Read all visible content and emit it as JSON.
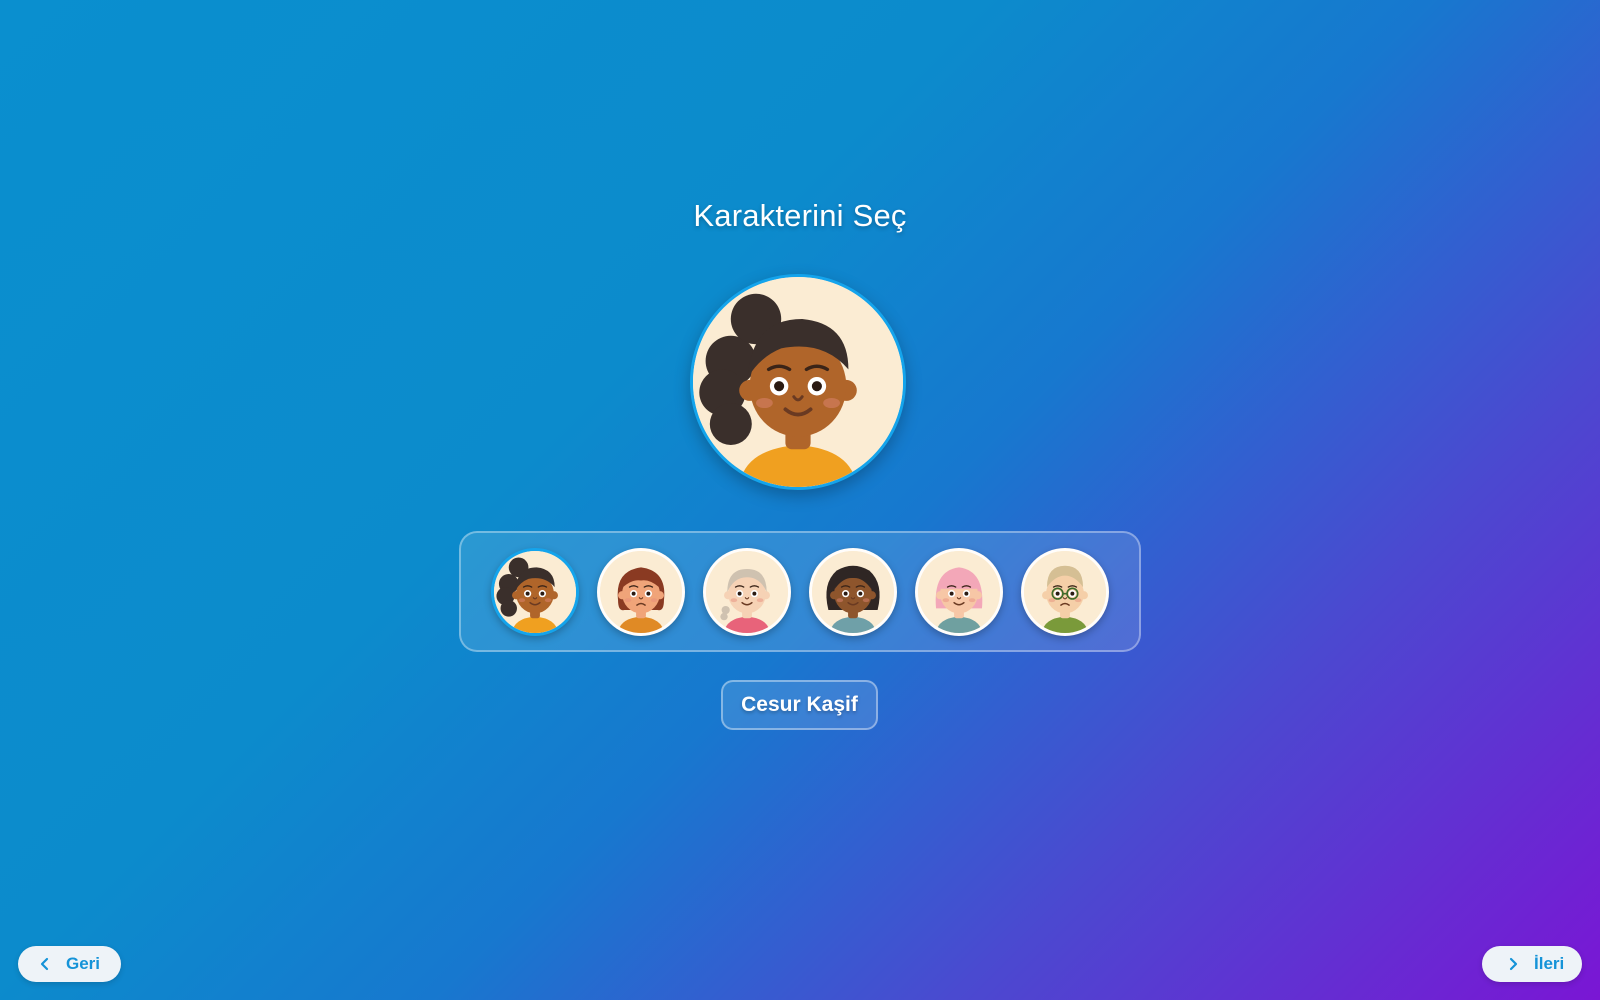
{
  "title": "Karakterini Seç",
  "selected_index": 0,
  "selected_name": "Cesur Kaşif",
  "accent_color": "#14a4ec",
  "characters": [
    {
      "id": "c1",
      "skin": "#b0652a",
      "hair": "#3a2f2b",
      "shirt": "#f0a020",
      "style": "curly-side",
      "mood": "smile"
    },
    {
      "id": "c2",
      "skin": "#f0a479",
      "hair": "#8a3a22",
      "shirt": "#e08a25",
      "style": "bob",
      "mood": "sad"
    },
    {
      "id": "c3",
      "skin": "#f6d2b5",
      "hair": "#cfc2b0",
      "shirt": "#e8637a",
      "style": "braid",
      "mood": "smile"
    },
    {
      "id": "c4",
      "skin": "#8e552c",
      "hair": "#2f2624",
      "shirt": "#6fa0a8",
      "style": "curly-long",
      "mood": "smile"
    },
    {
      "id": "c5",
      "skin": "#f7c7a6",
      "hair": "#f3a7b8",
      "shirt": "#6fa0a0",
      "style": "bangs",
      "mood": "smile"
    },
    {
      "id": "c6",
      "skin": "#f5cfa8",
      "hair": "#d5bf94",
      "shirt": "#7a9a3a",
      "style": "glasses",
      "mood": "sad"
    }
  ],
  "nav": {
    "back_label": "Geri",
    "next_label": "İleri",
    "back_icon": "chevron-left-icon",
    "next_icon": "chevron-right-icon"
  }
}
